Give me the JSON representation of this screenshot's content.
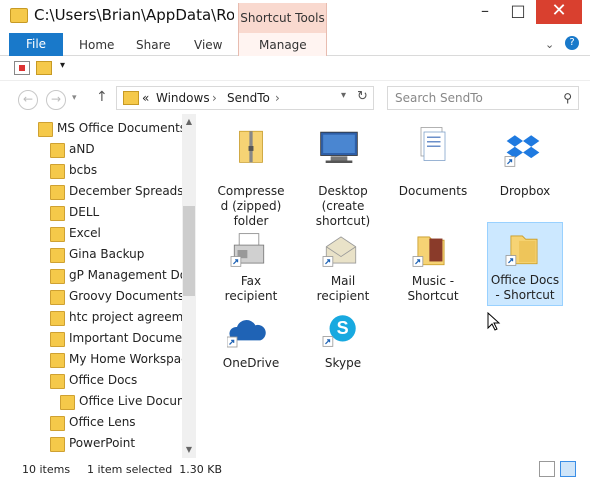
{
  "window": {
    "title": "C:\\Users\\Brian\\AppData\\Roa...",
    "contextual_tab_group": "Shortcut Tools"
  },
  "ribbon": {
    "tabs": [
      "File",
      "Home",
      "Share",
      "View",
      "Manage"
    ]
  },
  "address": {
    "crumbs": [
      "«",
      "Windows",
      "›",
      "SendTo",
      "›"
    ]
  },
  "search": {
    "placeholder": "Search SendTo"
  },
  "nav_tree": {
    "items": [
      {
        "label": "MS Office Documents",
        "level": 0
      },
      {
        "label": "aND",
        "level": 1
      },
      {
        "label": "bcbs",
        "level": 1
      },
      {
        "label": "December Spreadshe",
        "level": 1
      },
      {
        "label": "DELL",
        "level": 1
      },
      {
        "label": "Excel",
        "level": 1
      },
      {
        "label": "Gina Backup",
        "level": 1
      },
      {
        "label": "gP Management Doc",
        "level": 1
      },
      {
        "label": "Groovy Documents",
        "level": 1
      },
      {
        "label": "htc project agreemen",
        "level": 1
      },
      {
        "label": "Important Document",
        "level": 1
      },
      {
        "label": "My Home Workspace",
        "level": 1
      },
      {
        "label": "Office Docs",
        "level": 1
      },
      {
        "label": "Office Live Docume",
        "level": 2
      },
      {
        "label": "Office Lens",
        "level": 1
      },
      {
        "label": "PowerPoint",
        "level": 1
      }
    ]
  },
  "files": [
    {
      "label": "Compresse d (zipped) folder",
      "icon": "zip-folder-icon"
    },
    {
      "label": "Desktop (create shortcut)",
      "icon": "desktop-icon"
    },
    {
      "label": "Documents",
      "icon": "documents-icon"
    },
    {
      "label": "Dropbox",
      "icon": "dropbox-icon"
    },
    {
      "label": "Fax recipient",
      "icon": "fax-icon"
    },
    {
      "label": "Mail recipient",
      "icon": "mail-icon"
    },
    {
      "label": "Music - Shortcut",
      "icon": "music-folder-icon"
    },
    {
      "label": "Office Docs - Shortcut",
      "icon": "folder-shortcut-icon",
      "selected": true
    },
    {
      "label": "OneDrive",
      "icon": "onedrive-icon"
    },
    {
      "label": "Skype",
      "icon": "skype-icon"
    }
  ],
  "status": {
    "count": "10 items",
    "selection": "1 item selected  1.30 KB"
  },
  "colors": {
    "accent": "#1979ca",
    "contextual": "#f9d9cf",
    "selected": "#cce8ff",
    "close": "#d9402f"
  }
}
